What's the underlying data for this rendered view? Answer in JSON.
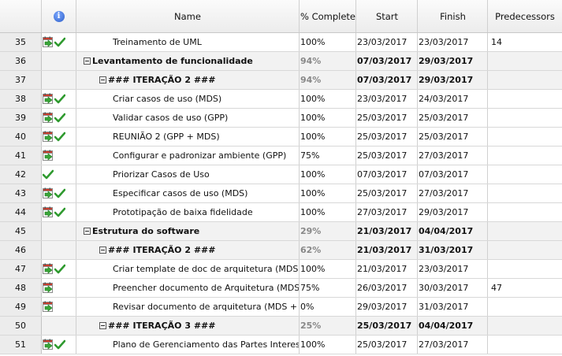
{
  "columns": {
    "info_icon": "info-icon",
    "name": "Name",
    "pct": "% Complete",
    "start": "Start",
    "finish": "Finish",
    "predecessors": "Predecessors"
  },
  "rows": [
    {
      "id": "35",
      "cal": true,
      "check": true,
      "summary": false,
      "level": 2,
      "name": "Treinamento de UML",
      "pct": "100%",
      "start": "23/03/2017",
      "finish": "23/03/2017",
      "pred": "14"
    },
    {
      "id": "36",
      "cal": false,
      "check": false,
      "summary": true,
      "level": 0,
      "name": "Levantamento de funcionalidade",
      "pct": "94%",
      "start": "07/03/2017",
      "finish": "29/03/2017",
      "pred": ""
    },
    {
      "id": "37",
      "cal": false,
      "check": false,
      "summary": true,
      "level": 1,
      "name": "### ITERAÇÃO 2 ###",
      "pct": "94%",
      "start": "07/03/2017",
      "finish": "29/03/2017",
      "pred": ""
    },
    {
      "id": "38",
      "cal": true,
      "check": true,
      "summary": false,
      "level": 2,
      "name": "Criar casos de uso (MDS)",
      "pct": "100%",
      "start": "23/03/2017",
      "finish": "24/03/2017",
      "pred": ""
    },
    {
      "id": "39",
      "cal": true,
      "check": true,
      "summary": false,
      "level": 2,
      "name": "Validar casos de uso (GPP)",
      "pct": "100%",
      "start": "25/03/2017",
      "finish": "25/03/2017",
      "pred": ""
    },
    {
      "id": "40",
      "cal": true,
      "check": true,
      "summary": false,
      "level": 2,
      "name": "REUNIÃO 2 (GPP + MDS)",
      "pct": "100%",
      "start": "25/03/2017",
      "finish": "25/03/2017",
      "pred": ""
    },
    {
      "id": "41",
      "cal": true,
      "check": false,
      "summary": false,
      "level": 2,
      "name": "Configurar e padronizar ambiente (GPP)",
      "pct": "75%",
      "start": "25/03/2017",
      "finish": "27/03/2017",
      "pred": ""
    },
    {
      "id": "42",
      "cal": false,
      "check": true,
      "summary": false,
      "level": 2,
      "name": "Priorizar Casos de Uso",
      "pct": "100%",
      "start": "07/03/2017",
      "finish": "07/03/2017",
      "pred": ""
    },
    {
      "id": "43",
      "cal": true,
      "check": true,
      "summary": false,
      "level": 2,
      "name": "Especificar casos de uso (MDS)",
      "pct": "100%",
      "start": "25/03/2017",
      "finish": "27/03/2017",
      "pred": ""
    },
    {
      "id": "44",
      "cal": true,
      "check": true,
      "summary": false,
      "level": 2,
      "name": "Prototipação de baixa fidelidade",
      "pct": "100%",
      "start": "27/03/2017",
      "finish": "29/03/2017",
      "pred": ""
    },
    {
      "id": "45",
      "cal": false,
      "check": false,
      "summary": true,
      "level": 0,
      "name": "Estrutura do software",
      "pct": "29%",
      "start": "21/03/2017",
      "finish": "04/04/2017",
      "pred": ""
    },
    {
      "id": "46",
      "cal": false,
      "check": false,
      "summary": true,
      "level": 1,
      "name": "### ITERAÇÃO 2 ###",
      "pct": "62%",
      "start": "21/03/2017",
      "finish": "31/03/2017",
      "pred": ""
    },
    {
      "id": "47",
      "cal": true,
      "check": true,
      "summary": false,
      "level": 2,
      "name": "Criar template de doc de arquitetura (MDS)",
      "pct": "100%",
      "start": "21/03/2017",
      "finish": "23/03/2017",
      "pred": ""
    },
    {
      "id": "48",
      "cal": true,
      "check": false,
      "summary": false,
      "level": 2,
      "name": "Preencher documento de Arquitetura (MDS)",
      "pct": "75%",
      "start": "26/03/2017",
      "finish": "30/03/2017",
      "pred": "47"
    },
    {
      "id": "49",
      "cal": true,
      "check": false,
      "summary": false,
      "level": 2,
      "name": "Revisar documento de arquitetura (MDS + GPP)",
      "pct": "0%",
      "start": "29/03/2017",
      "finish": "31/03/2017",
      "pred": ""
    },
    {
      "id": "50",
      "cal": false,
      "check": false,
      "summary": true,
      "level": 1,
      "name": "### ITERAÇÃO 3 ###",
      "pct": "25%",
      "start": "25/03/2017",
      "finish": "04/04/2017",
      "pred": ""
    },
    {
      "id": "51",
      "cal": true,
      "check": true,
      "summary": false,
      "level": 2,
      "name": "Plano de Gerenciamento das Partes Interessadas",
      "pct": "100%",
      "start": "25/03/2017",
      "finish": "27/03/2017",
      "pred": ""
    }
  ]
}
